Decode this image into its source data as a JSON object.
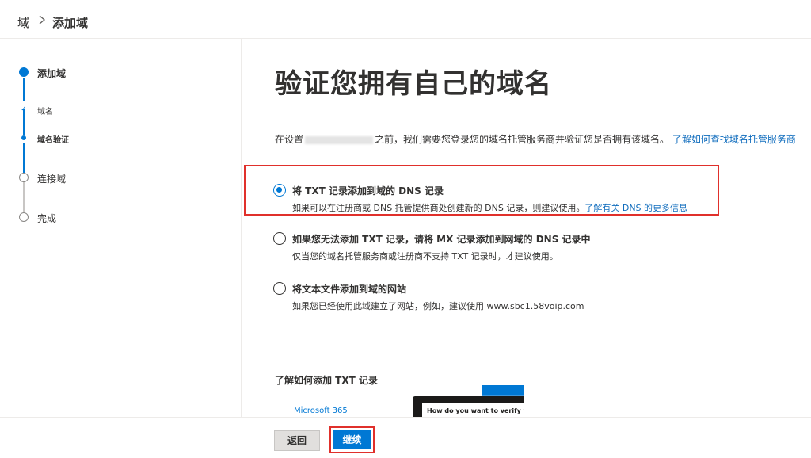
{
  "breadcrumb": {
    "root": "域",
    "current": "添加域"
  },
  "steps": [
    {
      "label": "添加域",
      "state": "current"
    },
    {
      "label": "域名",
      "state": "done",
      "sub": true
    },
    {
      "label": "域名验证",
      "state": "current",
      "sub": true
    },
    {
      "label": "连接域",
      "state": "pending"
    },
    {
      "label": "完成",
      "state": "pending"
    }
  ],
  "main": {
    "title": "验证您拥有自己的域名",
    "description_before": "在设置",
    "description_after": "之前，我们需要您登录您的域名托管服务商并验证您是否拥有该域名。",
    "description_link": "了解如何查找域名托管服务商",
    "options": [
      {
        "title": "将 TXT 记录添加到域的 DNS 记录",
        "desc": "如果可以在注册商或 DNS 托管提供商处创建新的 DNS 记录，则建议使用。",
        "link": "了解有关 DNS 的更多信息",
        "selected": true
      },
      {
        "title": "如果您无法添加 TXT 记录，请将 MX 记录添加到网域的 DNS 记录中",
        "desc": "仅当您的域名托管服务商或注册商不支持 TXT 记录时，才建议使用。",
        "selected": false
      },
      {
        "title": "将文本文件添加到域的网站",
        "desc": "如果您已经使用此域建立了网站，例如，建议使用 www.sbc1.58voip.com",
        "selected": false
      }
    ],
    "learn_title": "了解如何添加 TXT 记录",
    "video_brand": "Microsoft 365",
    "video_caption": "How do you want to verify y"
  },
  "footer": {
    "back_label": "返回",
    "next_label": "继续"
  },
  "colors": {
    "accent": "#0078d4",
    "highlight": "#e0302b",
    "link": "#0f6cbd"
  }
}
